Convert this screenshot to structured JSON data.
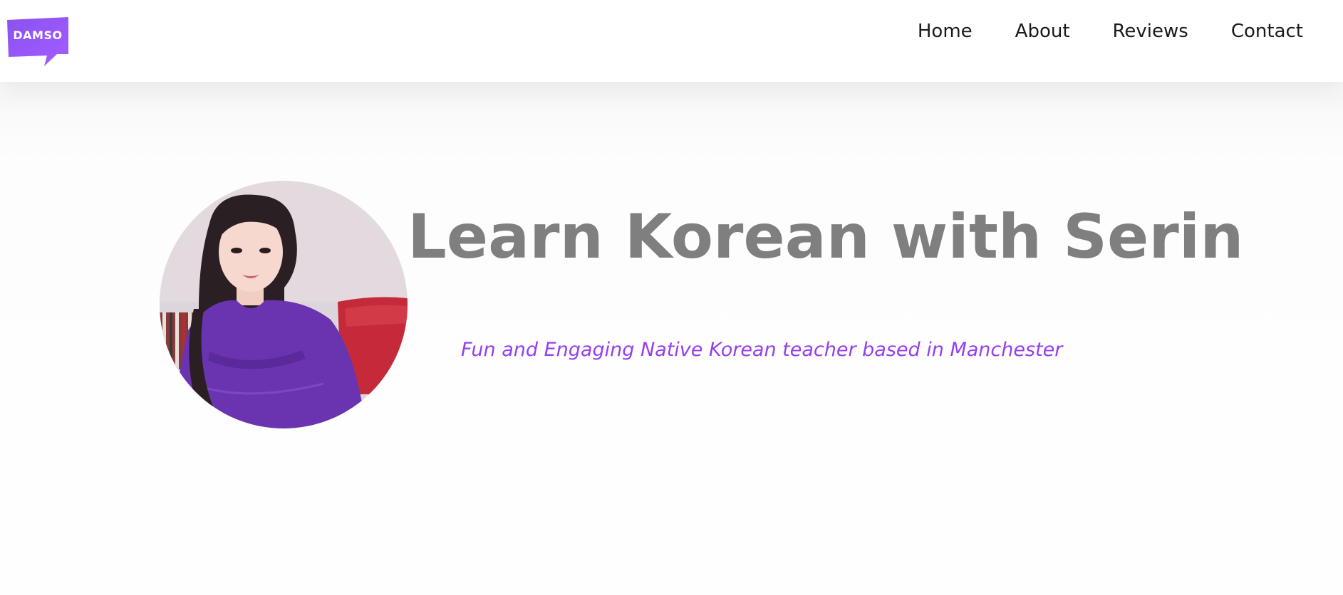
{
  "brand": {
    "logo_text": "DAMSO",
    "logo_color": "#8e4ff2"
  },
  "nav": {
    "items": [
      {
        "label": "Home"
      },
      {
        "label": "About"
      },
      {
        "label": "Reviews"
      },
      {
        "label": "Contact"
      }
    ]
  },
  "hero": {
    "title": "Learn Korean with Serin",
    "subtitle": "Fun and Engaging Native Korean teacher based in Manchester",
    "title_color": "#7f7f7f",
    "subtitle_color": "#9440ee"
  }
}
